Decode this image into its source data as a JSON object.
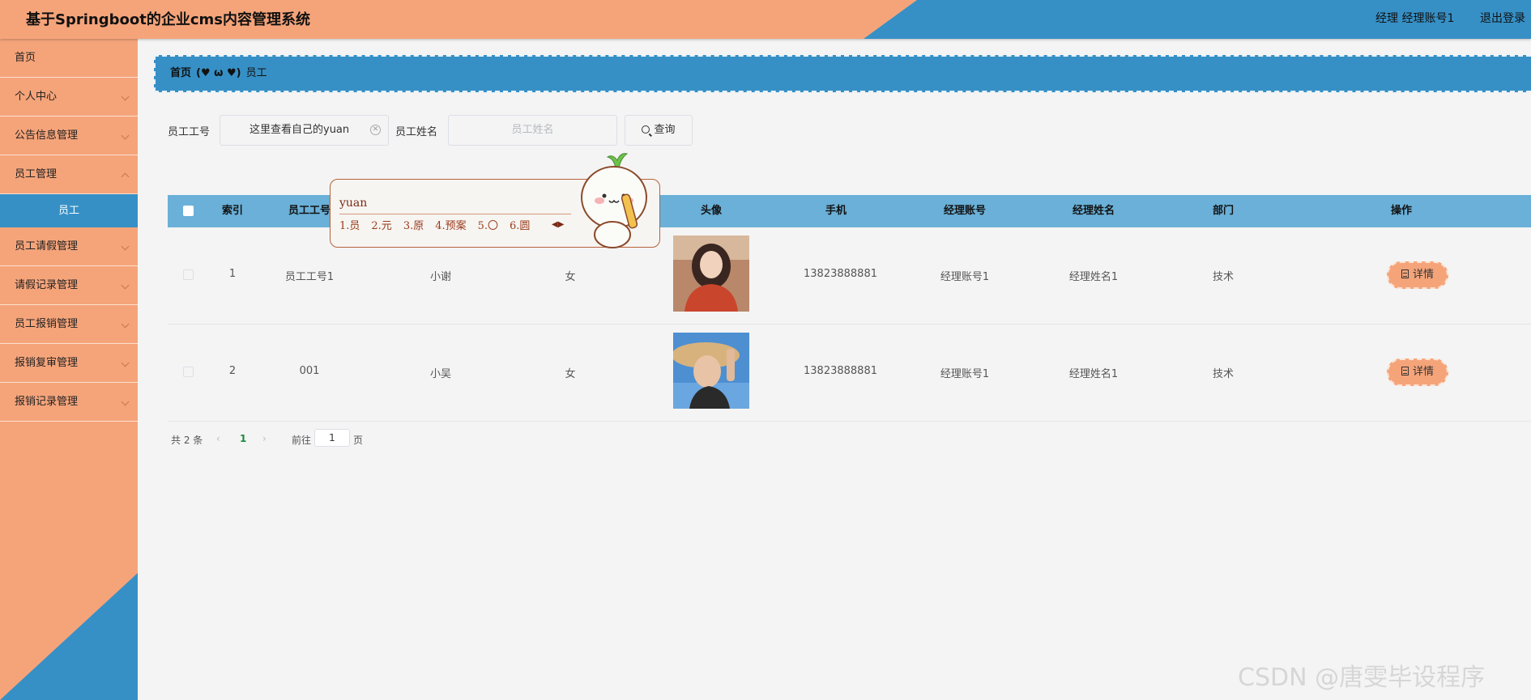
{
  "header": {
    "title": "基于Springboot的企业cms内容管理系统",
    "user": "经理 经理账号1",
    "logout": "退出登录"
  },
  "sidebar": {
    "items": [
      {
        "label": "首页"
      },
      {
        "label": "个人中心"
      },
      {
        "label": "公告信息管理"
      },
      {
        "label": "员工管理"
      },
      {
        "label": "员工请假管理"
      },
      {
        "label": "请假记录管理"
      },
      {
        "label": "员工报销管理"
      },
      {
        "label": "报销复审管理"
      },
      {
        "label": "报销记录管理"
      }
    ],
    "active_sub": "员工"
  },
  "breadcrumb": {
    "home": "首页",
    "separator": "(♥ ω ♥)",
    "current": "员工"
  },
  "search": {
    "field1_label": "员工工号",
    "field1_value": "这里查看自己的yuan",
    "field2_label": "员工姓名",
    "field2_placeholder": "员工姓名",
    "query_label": "查询"
  },
  "table": {
    "columns": [
      "索引",
      "员工工号",
      "头像",
      "手机",
      "经理账号",
      "经理姓名",
      "部门",
      "操作"
    ],
    "rows": [
      {
        "index": "1",
        "emp_no": "员工工号1",
        "name": "小谢",
        "gender": "女",
        "phone": "13823888881",
        "mgr_account": "经理账号1",
        "mgr_name": "经理姓名1",
        "dept": "技术",
        "action": "详情"
      },
      {
        "index": "2",
        "emp_no": "001",
        "name": "小吴",
        "gender": "女",
        "phone": "13823888881",
        "mgr_account": "经理账号1",
        "mgr_name": "经理姓名1",
        "dept": "技术",
        "action": "详情"
      }
    ]
  },
  "pagination": {
    "total": "共 2 条",
    "current_page": "1",
    "goto_prefix": "前往",
    "goto_value": "1",
    "goto_suffix": "页"
  },
  "ime": {
    "composition": "yuan",
    "candidates": [
      "1.员",
      "2.元",
      "3.原",
      "4.预案",
      "5.〇",
      "6.圆"
    ]
  },
  "watermark": "CSDN @唐雯毕设程序",
  "colors": {
    "orange": "#f5a47a",
    "blue": "#3690c6",
    "table_header": "#6ab0d8",
    "background": "#f4f4f4"
  }
}
